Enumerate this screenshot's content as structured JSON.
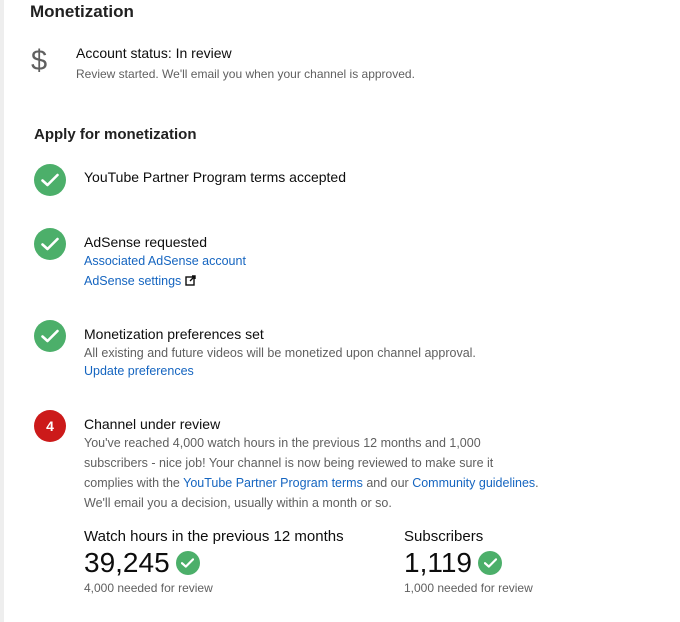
{
  "page": {
    "title": "Monetization"
  },
  "account_status": {
    "icon": "dollar-icon",
    "icon_glyph": "$",
    "title": "Account status: In review",
    "description": "Review started. We'll email you when your channel is approved."
  },
  "apply": {
    "title": "Apply for monetization",
    "steps": [
      {
        "title": "YouTube Partner Program terms accepted",
        "state": "done"
      },
      {
        "title": "AdSense requested",
        "state": "done",
        "links": [
          "Associated AdSense account",
          "AdSense settings"
        ]
      },
      {
        "title": "Monetization preferences set",
        "state": "done",
        "description": "All existing and future videos will be monetized upon channel approval.",
        "links": [
          "Update preferences"
        ]
      },
      {
        "number": "4",
        "title": "Channel under review",
        "state": "current",
        "desc_line1": "You've reached 4,000 watch hours in the previous 12 months and 1,000",
        "desc_line2": "subscribers - nice job! Your channel is now being reviewed to make sure it",
        "desc_line3_pre": "complies with the ",
        "desc_link1": "YouTube Partner Program terms",
        "desc_line3_mid": " and our ",
        "desc_link2": "Community guidelines",
        "desc_line3_post": ".",
        "desc_line4": "We'll email you a decision, usually within a month or so."
      }
    ]
  },
  "stats": [
    {
      "label": "Watch hours in the previous 12 months",
      "value": "39,245",
      "note": "4,000 needed for review"
    },
    {
      "label": "Subscribers",
      "value": "1,119",
      "note": "1,000 needed for review"
    }
  ],
  "colors": {
    "success": "#4caf6a",
    "current": "#cc1a1a",
    "link": "#1565c0"
  }
}
